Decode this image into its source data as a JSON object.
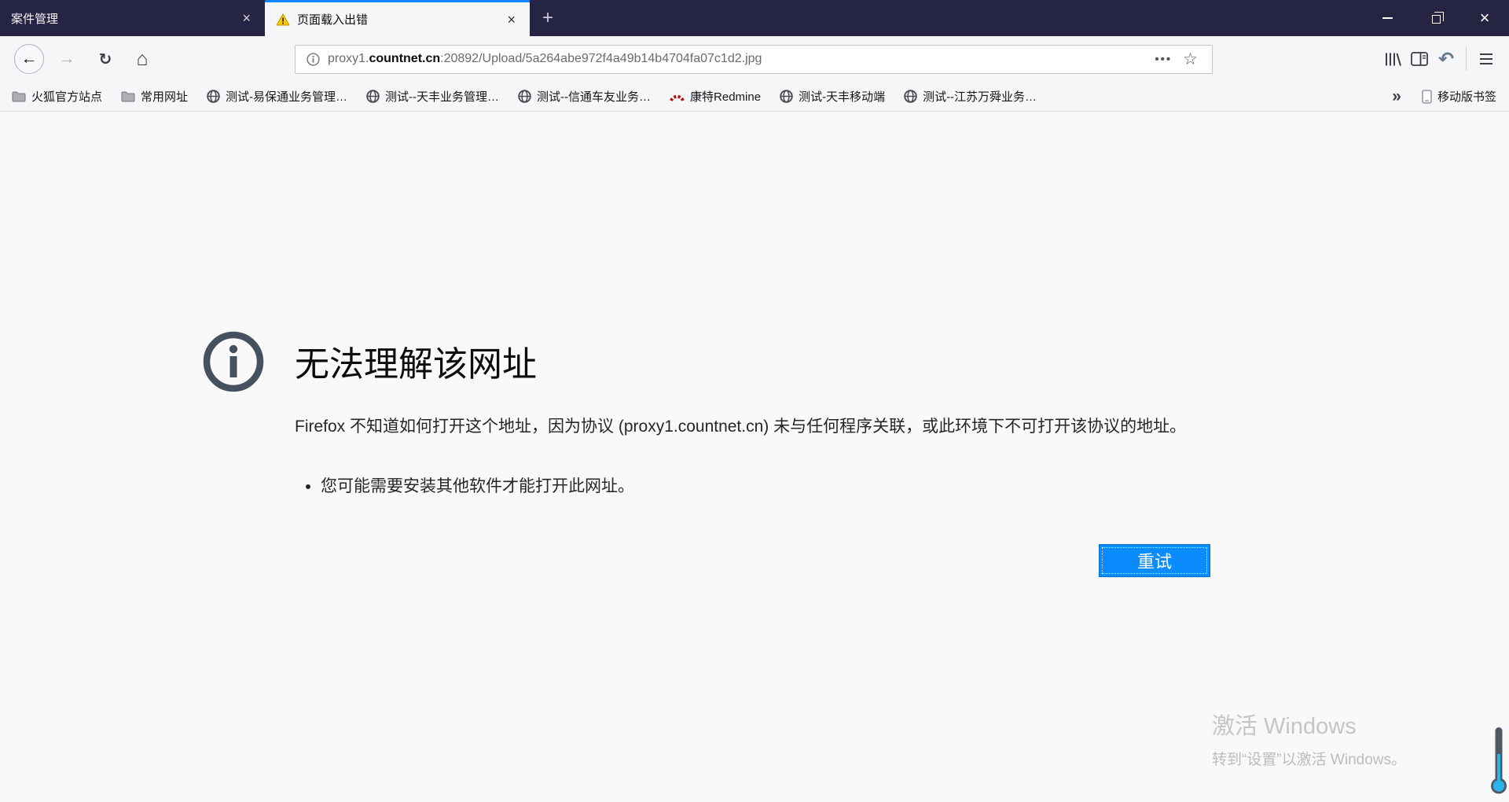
{
  "window_title_bar": {
    "tabs": [
      {
        "title": "案件管理",
        "active": false
      },
      {
        "title": "页面载入出错",
        "active": true
      }
    ]
  },
  "toolbar": {
    "url_bar": {
      "url_prefix": "proxy1.",
      "url_domain": "countnet.cn",
      "url_path": ":20892/Upload/5a264abe972f4a49b14b4704fa07c1d2.jpg"
    }
  },
  "bookmarks_bar": {
    "items": [
      {
        "label": "火狐官方站点",
        "icon": "folder"
      },
      {
        "label": "常用网址",
        "icon": "folder"
      },
      {
        "label": "测试-易保通业务管理…",
        "icon": "globe"
      },
      {
        "label": "测试--天丰业务管理…",
        "icon": "globe"
      },
      {
        "label": "测试--信通车友业务…",
        "icon": "globe"
      },
      {
        "label": "康特Redmine",
        "icon": "redmine"
      },
      {
        "label": "测试-天丰移动端",
        "icon": "globe"
      },
      {
        "label": "测试--江苏万舜业务…",
        "icon": "globe"
      }
    ],
    "mobile_bookmarks_label": "移动版书签"
  },
  "error_page": {
    "title": "无法理解该网址",
    "description": "Firefox 不知道如何打开这个地址，因为协议 (proxy1.countnet.cn) 未与任何程序关联，或此环境下不可打开该协议的地址。",
    "suggestion": "您可能需要安装其他软件才能打开此网址。",
    "retry_button": "重试"
  },
  "watermark": {
    "line1": "激活 Windows",
    "line2": "转到“设置”以激活 Windows。"
  },
  "glyphs": {
    "close": "×",
    "new_tab": "+",
    "back": "←",
    "forward": "→",
    "reload": "↻",
    "home": "⌂",
    "page_actions": "•••",
    "star": "☆",
    "undo": "↶",
    "overflow_chevron": "»"
  },
  "colors": {
    "accent_blue": "#0a84ff",
    "titlebar": "#252442",
    "toolbar_bg": "#f5f6f7",
    "content_bg": "#f9f9fa",
    "retry_button_blue": "#0a8bfe",
    "warning_yellow": "#ffcb00",
    "redmine_red": "#bc0b0b"
  }
}
